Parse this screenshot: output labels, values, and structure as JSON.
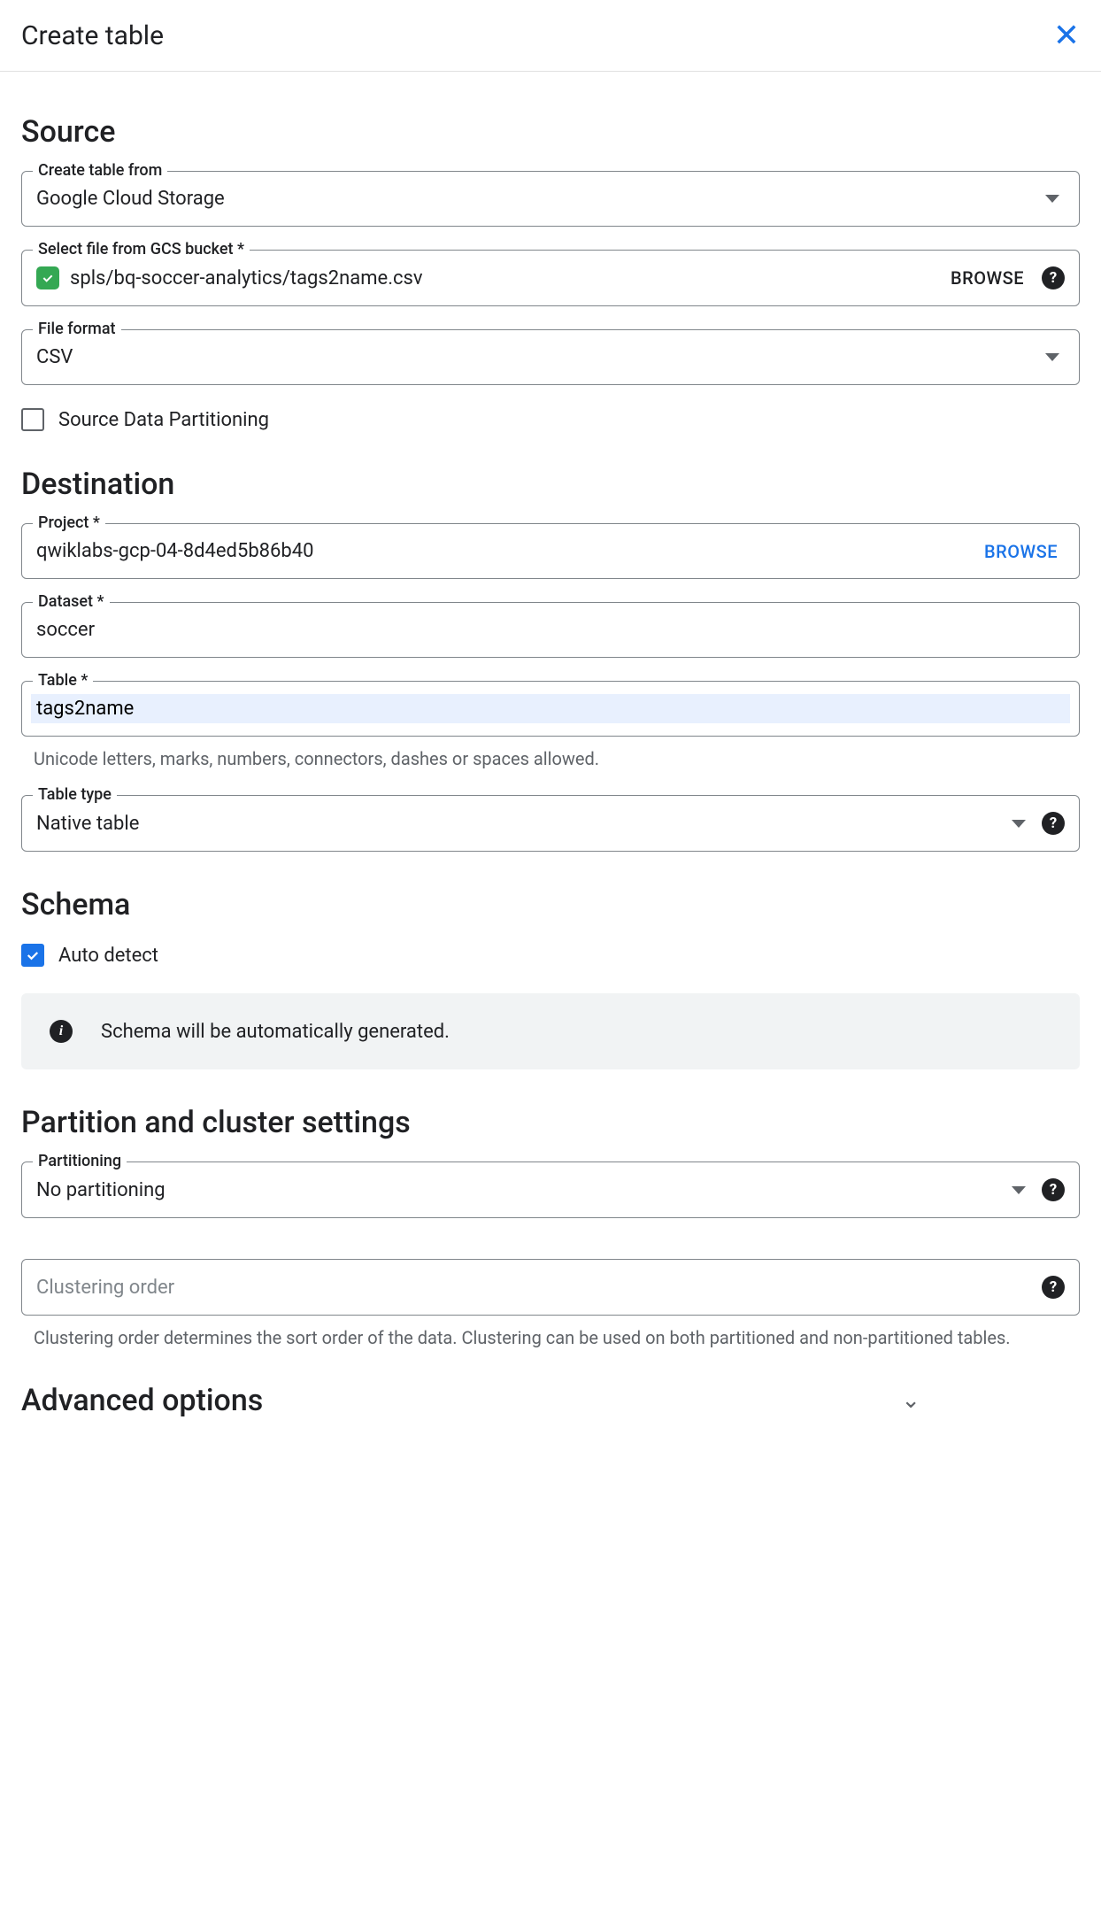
{
  "header": {
    "title": "Create table"
  },
  "source": {
    "title": "Source",
    "create_from": {
      "label": "Create table from",
      "value": "Google Cloud Storage"
    },
    "gcs": {
      "label": "Select file from GCS bucket *",
      "value": "spls/bq-soccer-analytics/tags2name.csv",
      "browse": "BROWSE"
    },
    "file_format": {
      "label": "File format",
      "value": "CSV"
    },
    "partition_checkbox": "Source Data Partitioning"
  },
  "destination": {
    "title": "Destination",
    "project": {
      "label": "Project *",
      "value": "qwiklabs-gcp-04-8d4ed5b86b40",
      "browse": "BROWSE"
    },
    "dataset": {
      "label": "Dataset *",
      "value": "soccer"
    },
    "table": {
      "label": "Table *",
      "value": "tags2name",
      "hint": "Unicode letters, marks, numbers, connectors, dashes or spaces allowed."
    },
    "table_type": {
      "label": "Table type",
      "value": "Native table"
    }
  },
  "schema": {
    "title": "Schema",
    "auto_detect": "Auto detect",
    "info": "Schema will be automatically generated."
  },
  "partition": {
    "title": "Partition and cluster settings",
    "partitioning": {
      "label": "Partitioning",
      "value": "No partitioning"
    },
    "clustering": {
      "placeholder": "Clustering order",
      "hint": "Clustering order determines the sort order of the data. Clustering can be used on both partitioned and non-partitioned tables."
    }
  },
  "advanced": {
    "title": "Advanced options"
  }
}
